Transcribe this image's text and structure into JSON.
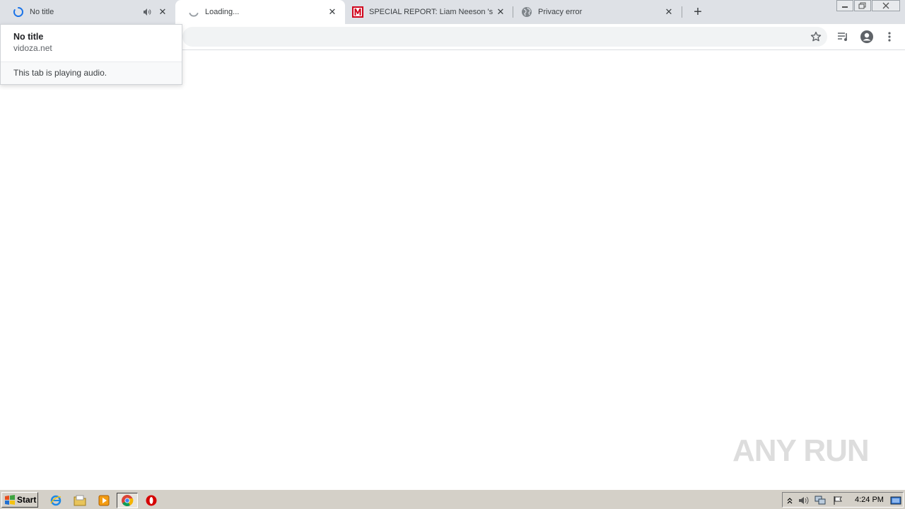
{
  "browser": {
    "tabs": [
      {
        "title": "No title",
        "favicon": "loading-spinner-icon",
        "audio": true,
        "active": false
      },
      {
        "title": "Loading...",
        "favicon": "loading-spinner-icon",
        "audio": false,
        "active": true
      },
      {
        "title": "SPECIAL REPORT: Liam Neeson 's La",
        "favicon": "m-logo-icon",
        "audio": false,
        "active": false
      },
      {
        "title": "Privacy error",
        "favicon": "globe-icon",
        "audio": false,
        "active": false
      }
    ],
    "new_tab_label": "+",
    "hovercard": {
      "title": "No title",
      "domain": "vidoza.net",
      "audio_text": "This tab is playing audio."
    },
    "omnibox": {
      "value": ""
    }
  },
  "watermark": {
    "text": "ANY RUN"
  },
  "taskbar": {
    "start_label": "Start",
    "clock": "4:24 PM"
  },
  "colors": {
    "tabstrip": "#dee1e6",
    "accent_blue": "#1a73e8",
    "taskbar": "#d4d0c8",
    "m_logo_red": "#d0021b"
  }
}
